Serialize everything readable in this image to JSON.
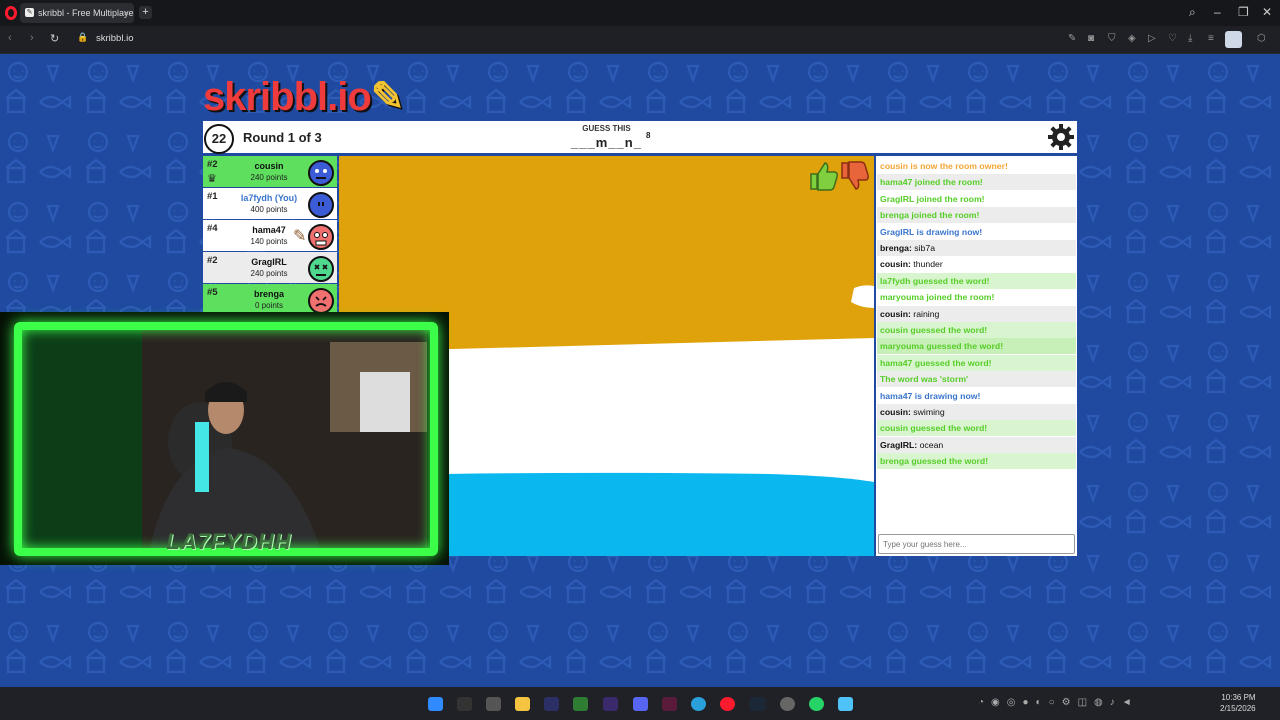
{
  "browser": {
    "tab_title": "skribbl - Free Multiplayer",
    "tab_close": "×",
    "new_tab": "+",
    "url": "skribbl.io"
  },
  "logo": {
    "text": "skribbl.io"
  },
  "game": {
    "timer": "22",
    "round": "Round 1 of 3",
    "guess_label": "GUESS THIS",
    "word_hint": "___m__n_",
    "word_length": "8"
  },
  "players": [
    {
      "rank": "#2",
      "name": "cousin",
      "points": "240 points",
      "color": "#5ee05e",
      "is_owner": true,
      "avatar_color": "#3c5bd6"
    },
    {
      "rank": "#1",
      "name": "la7fydh (You)",
      "points": "400 points",
      "color": "#ffffff",
      "avatar_color": "#3c5bd6"
    },
    {
      "rank": "#4",
      "name": "hama47",
      "points": "140 points",
      "color": "#ffffff",
      "drawing": true,
      "avatar_color": "#f07070"
    },
    {
      "rank": "#2",
      "name": "GragIRL",
      "points": "240 points",
      "color": "#ececec",
      "avatar_color": "#4fd88e"
    },
    {
      "rank": "#5",
      "name": "brenga",
      "points": "0 points",
      "color": "#5ee05e",
      "avatar_color": "#f07070"
    }
  ],
  "chat": [
    {
      "text": "cousin is now the room owner!",
      "color": "#f4a535",
      "bg": "#ffffff"
    },
    {
      "text": "hama47 joined the room!",
      "color": "#56ce27",
      "bg": "#ececec"
    },
    {
      "text": "GragIRL joined the room!",
      "color": "#56ce27",
      "bg": "#ffffff"
    },
    {
      "text": "brenga joined the room!",
      "color": "#56ce27",
      "bg": "#ececec"
    },
    {
      "text": "GragIRL is drawing now!",
      "color": "#3975ce",
      "bg": "#ffffff"
    },
    {
      "author": "brenga:",
      "text": " sib7a",
      "color": "#111111",
      "bg": "#ececec"
    },
    {
      "author": "cousin:",
      "text": " thunder",
      "color": "#111111",
      "bg": "#ffffff"
    },
    {
      "text": "la7fydh guessed the word!",
      "color": "#56ce27",
      "bg": "#d9f5cf"
    },
    {
      "text": "maryouma joined the room!",
      "color": "#56ce27",
      "bg": "#ffffff"
    },
    {
      "author": "cousin:",
      "text": " raining",
      "color": "#111111",
      "bg": "#ececec"
    },
    {
      "text": "cousin guessed the word!",
      "color": "#56ce27",
      "bg": "#d9f5cf"
    },
    {
      "text": "maryouma guessed the word!",
      "color": "#56ce27",
      "bg": "#c7efb8"
    },
    {
      "text": "hama47 guessed the word!",
      "color": "#56ce27",
      "bg": "#d9f5cf"
    },
    {
      "text": "The word was 'storm'",
      "color": "#56ce27",
      "bg": "#ececec"
    },
    {
      "text": "hama47 is drawing now!",
      "color": "#3975ce",
      "bg": "#ffffff"
    },
    {
      "author": "cousin:",
      "text": " swiming",
      "color": "#111111",
      "bg": "#ececec"
    },
    {
      "text": "cousin guessed the word!",
      "color": "#56ce27",
      "bg": "#d9f5cf"
    },
    {
      "author": "GragIRL:",
      "text": " ocean",
      "color": "#111111",
      "bg": "#ececec"
    },
    {
      "text": "brenga guessed the word!",
      "color": "#56ce27",
      "bg": "#d9f5cf"
    }
  ],
  "chat_input": {
    "placeholder": "Type your guess here..."
  },
  "webcam": {
    "label": "LA7FYDHH"
  },
  "taskbar": {
    "time": "10:36 PM",
    "date": "2/15/2026"
  },
  "colors": {
    "page_bg": "#1f4aa0",
    "sand": "#e0a20a",
    "sea": "#0ab8ef",
    "you_name": "#3975ce"
  }
}
